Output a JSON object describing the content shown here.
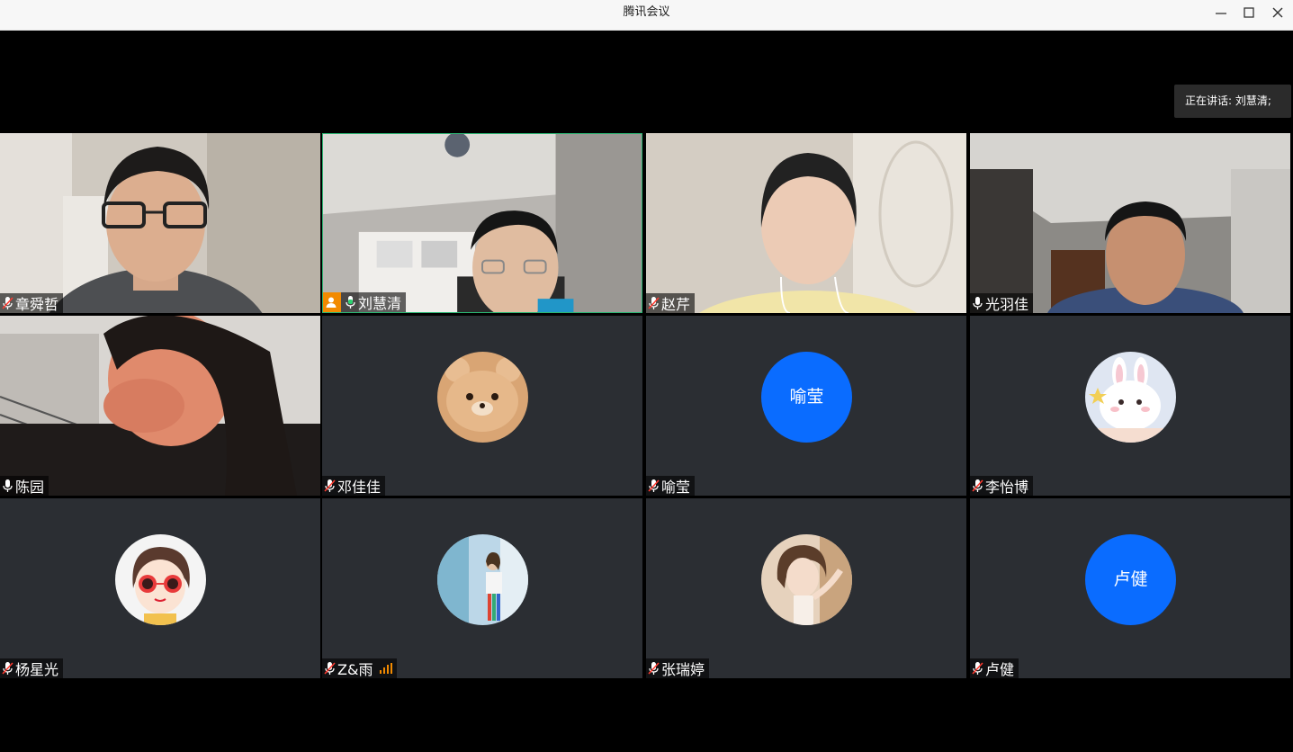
{
  "window": {
    "title": "腾讯会议"
  },
  "speaking": {
    "text": "正在讲话: 刘慧清;"
  },
  "participants": [
    {
      "name": "章舜哲",
      "mic": "muted",
      "type": "video"
    },
    {
      "name": "刘慧清",
      "mic": "speaking",
      "type": "video",
      "host": true
    },
    {
      "name": "赵芹",
      "mic": "muted",
      "type": "video"
    },
    {
      "name": "光羽佳",
      "mic": "on",
      "type": "video"
    },
    {
      "name": "陈园",
      "mic": "on",
      "type": "video"
    },
    {
      "name": "邓佳佳",
      "mic": "muted",
      "type": "avatar",
      "avatar_icon": "bear-avatar-icon"
    },
    {
      "name": "喻莹",
      "mic": "muted",
      "type": "text-avatar",
      "avatar_text": "喻莹"
    },
    {
      "name": "李怡博",
      "mic": "muted",
      "type": "avatar",
      "avatar_icon": "bunny-avatar-icon"
    },
    {
      "name": "杨星光",
      "mic": "muted",
      "type": "avatar",
      "avatar_icon": "cartoon-girl-avatar-icon"
    },
    {
      "name": "Z&雨",
      "mic": "muted",
      "type": "avatar",
      "avatar_icon": "photo-avatar-icon",
      "signal": "network-signal-icon"
    },
    {
      "name": "张瑞婷",
      "mic": "muted",
      "type": "avatar",
      "avatar_icon": "portrait-avatar-icon"
    },
    {
      "name": "卢健",
      "mic": "muted",
      "type": "text-avatar",
      "avatar_text": "卢健"
    }
  ],
  "colors": {
    "accent": "#0a6cff",
    "host_badge": "#f28a00",
    "active_border": "#2bb673",
    "tile_bg": "#2b2e33"
  }
}
